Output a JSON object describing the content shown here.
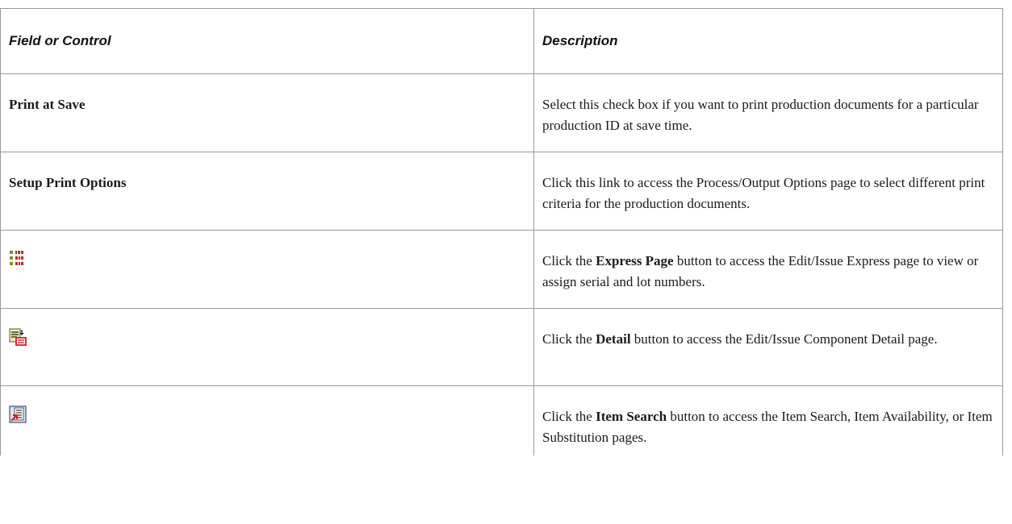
{
  "table": {
    "headers": [
      "Field or Control",
      "Description"
    ],
    "rows": [
      {
        "field_label": "Print at Save",
        "icon": null,
        "description": {
          "pre": "Select this check box if you want to print production documents for a particular production ID at save time.",
          "bold": "",
          "post": ""
        }
      },
      {
        "field_label": "Setup Print Options",
        "icon": null,
        "description": {
          "pre": "Click this link to access the Process/Output Options page to select different print criteria for the production documents.",
          "bold": "",
          "post": ""
        }
      },
      {
        "field_label": "",
        "icon": "express-page-icon",
        "description": {
          "pre": "Click the ",
          "bold": "Express Page",
          "post": " button to access the Edit/Issue Express page to view or assign serial and lot numbers."
        }
      },
      {
        "field_label": "",
        "icon": "detail-icon",
        "description": {
          "pre": "Click the ",
          "bold": "Detail",
          "post": " button to access the Edit/Issue Component Detail page."
        }
      },
      {
        "field_label": "",
        "icon": "item-search-icon",
        "description": {
          "pre": "Click the ",
          "bold": "Item Search",
          "post": " button to access the Item Search, Item Availability, or Item Substitution pages."
        }
      }
    ]
  },
  "colors": {
    "border": "#9a9a9a",
    "text": "#1a1a1a"
  }
}
